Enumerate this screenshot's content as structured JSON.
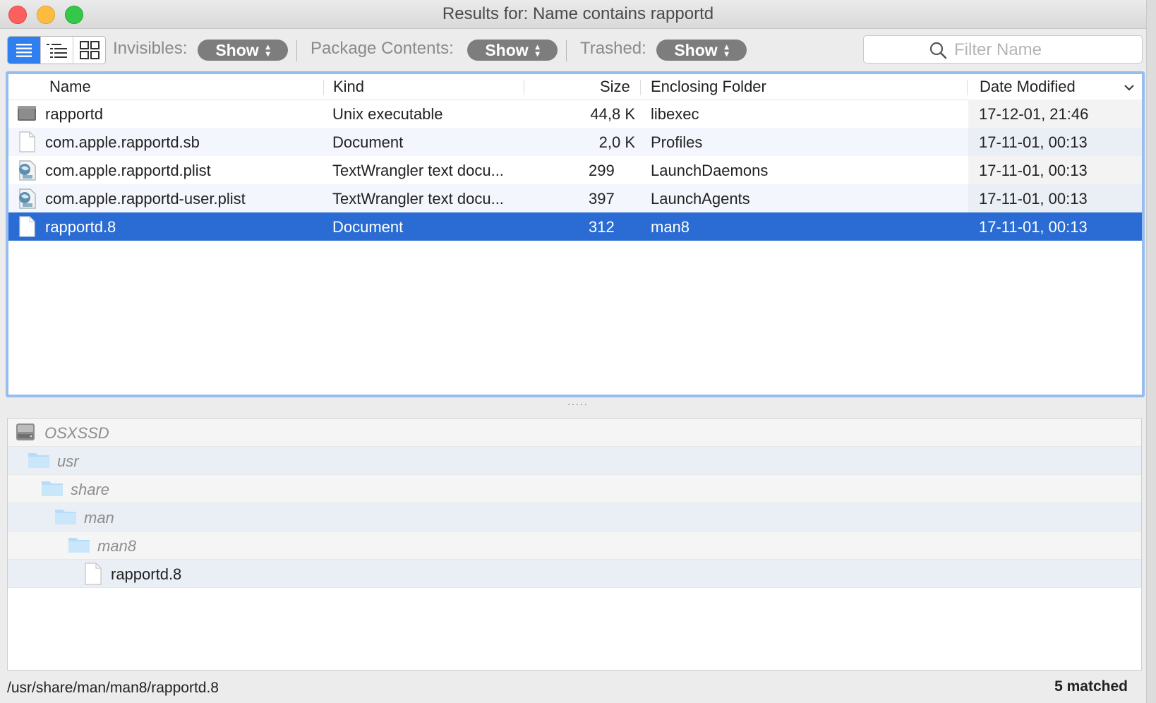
{
  "window": {
    "title": "Results for: Name contains rapportd"
  },
  "toolbar": {
    "view_modes": [
      {
        "icon": "list-view-icon",
        "active": true
      },
      {
        "icon": "outline-view-icon",
        "active": false
      },
      {
        "icon": "grid-view-icon",
        "active": false
      }
    ],
    "invisibles_label": "Invisibles:",
    "invisibles_value": "Show",
    "package_label": "Package Contents:",
    "package_value": "Show",
    "trashed_label": "Trashed:",
    "trashed_value": "Show",
    "filter_placeholder": "Filter Name"
  },
  "table": {
    "columns": {
      "name": "Name",
      "kind": "Kind",
      "size": "Size",
      "folder": "Enclosing Folder",
      "date": "Date Modified"
    },
    "rows": [
      {
        "icon": "executable-icon",
        "name": "rapportd",
        "kind": "Unix executable",
        "size": "44,8 K",
        "folder": "libexec",
        "date": "17-12-01, 21:46"
      },
      {
        "icon": "document-icon",
        "name": "com.apple.rapportd.sb",
        "kind": "Document",
        "size": "2,0 K",
        "folder": "Profiles",
        "date": "17-11-01, 00:13"
      },
      {
        "icon": "textwrangler-doc-icon",
        "name": "com.apple.rapportd.plist",
        "kind": "TextWrangler text docu...",
        "size": "299",
        "folder": "LaunchDaemons",
        "date": "17-11-01, 00:13"
      },
      {
        "icon": "textwrangler-doc-icon",
        "name": "com.apple.rapportd-user.plist",
        "kind": "TextWrangler text docu...",
        "size": "397",
        "folder": "LaunchAgents",
        "date": "17-11-01, 00:13"
      },
      {
        "icon": "document-icon",
        "name": "rapportd.8",
        "kind": "Document",
        "size": "312",
        "folder": "man8",
        "date": "17-11-01, 00:13",
        "selected": true
      }
    ]
  },
  "splitter": ".....",
  "path_panel": {
    "items": [
      {
        "icon": "hard-drive-icon",
        "label": "OSXSSD"
      },
      {
        "icon": "folder-icon",
        "label": "usr"
      },
      {
        "icon": "folder-icon",
        "label": "share"
      },
      {
        "icon": "folder-icon",
        "label": "man"
      },
      {
        "icon": "folder-icon",
        "label": "man8"
      },
      {
        "icon": "document-icon",
        "label": "rapportd.8"
      }
    ]
  },
  "status": {
    "path": "/usr/share/man/man8/rapportd.8",
    "matched": "5 matched"
  },
  "colors": {
    "selection": "#2a6cd3",
    "focus_ring": "#97bdf0",
    "pill": "#7d7d7d",
    "active_view": "#2f7ff0"
  }
}
